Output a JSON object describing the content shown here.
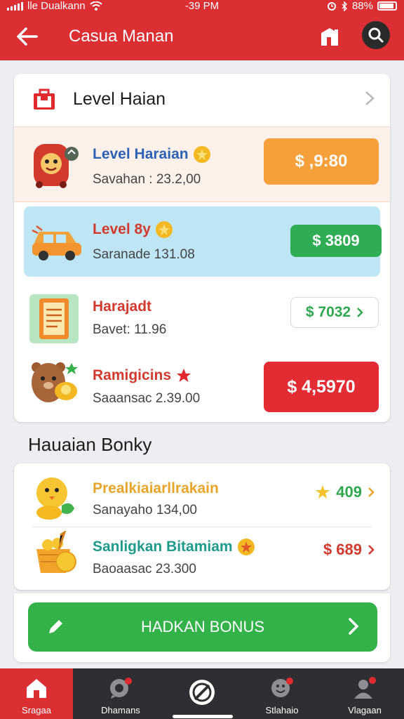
{
  "status": {
    "carrier": "lle Dualkann",
    "time": "-39 PM",
    "battery": "88%"
  },
  "header": {
    "title": "Casua Manan"
  },
  "main_card": {
    "title": "Level Haian",
    "rows": [
      {
        "name": "Level Haraian",
        "sub": "Savahan : 23.2,00",
        "price": "$ ,9:80",
        "color": "#f5a03a"
      },
      {
        "name": "Level 8y",
        "sub": "Saranade 131.08",
        "price": "$ 3809",
        "color": "#2fad55"
      },
      {
        "name": "Harajadt",
        "sub": "Bavet: 11.96",
        "price": "$ 7032",
        "color": "#2fa84f"
      },
      {
        "name": "Ramigicins",
        "sub": "Saaansac 2.39.00",
        "price": "$ 4,5970",
        "color": "#e32b33"
      }
    ]
  },
  "section": {
    "title": "Hauaian Bonky"
  },
  "bonus_rows": [
    {
      "name": "Prealkiaiarllrakain",
      "sub": "Sanayaho 134,00",
      "value": "409"
    },
    {
      "name": "Sanligkan Bitamiam",
      "sub": "Baoaasac 23.300",
      "value": "$ 689"
    }
  ],
  "bonus_button": {
    "label": "HADKAN BONUS"
  },
  "nav": [
    {
      "label": "Sragaa"
    },
    {
      "label": "Dhamans"
    },
    {
      "label": ""
    },
    {
      "label": "Stlahaio"
    },
    {
      "label": "Vlagaan"
    }
  ]
}
